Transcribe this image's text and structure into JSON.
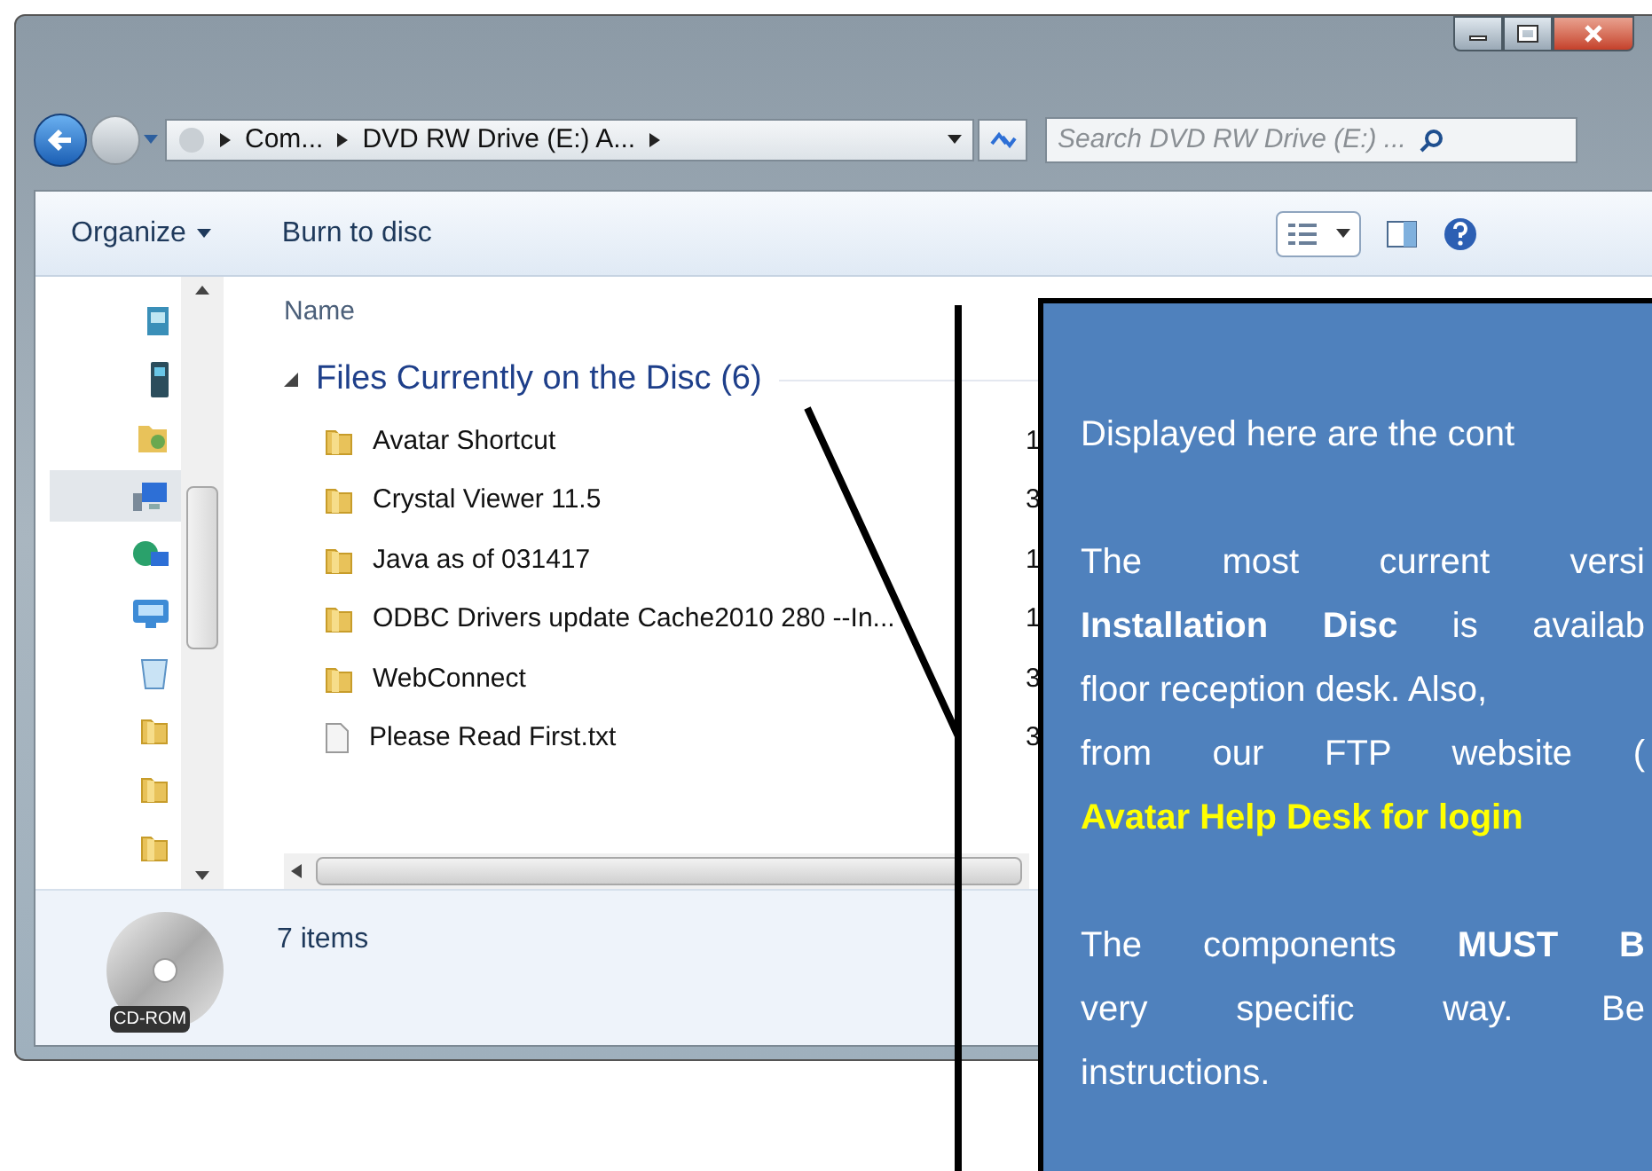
{
  "address_bar": {
    "segments": [
      "Com...",
      "DVD RW Drive (E:) A..."
    ]
  },
  "search": {
    "placeholder": "Search DVD RW Drive (E:) ..."
  },
  "toolbar": {
    "buttons": [
      "Organize",
      "Burn to disc"
    ]
  },
  "nav_pane": {
    "items": [
      {
        "kind": "picture",
        "selected": false
      },
      {
        "kind": "device",
        "selected": false
      },
      {
        "kind": "user",
        "selected": false
      },
      {
        "kind": "computer",
        "selected": true
      },
      {
        "kind": "network",
        "selected": false
      },
      {
        "kind": "panel",
        "selected": false
      },
      {
        "kind": "bin",
        "selected": false
      },
      {
        "kind": "folder",
        "selected": false
      },
      {
        "kind": "folder",
        "selected": false
      },
      {
        "kind": "folder",
        "selected": false
      }
    ]
  },
  "file_list": {
    "columns": [
      "Name"
    ],
    "group": {
      "title": "Files Currently on the Disc (6)",
      "expanded": true
    },
    "rows": [
      {
        "kind": "folder",
        "name": "Avatar Shortcut",
        "column_2": "1"
      },
      {
        "kind": "folder",
        "name": "Crystal Viewer 11.5",
        "column_2": "3"
      },
      {
        "kind": "folder",
        "name": "Java as of 031417",
        "column_2": "1"
      },
      {
        "kind": "folder",
        "name": "ODBC Drivers update Cache2010 280 --In...",
        "column_2": "1"
      },
      {
        "kind": "folder",
        "name": "WebConnect",
        "column_2": "3"
      },
      {
        "kind": "file",
        "name": "Please Read First.txt",
        "column_2": "3"
      }
    ]
  },
  "status_bar": {
    "drive_label": "CD-ROM",
    "count": "7 items"
  },
  "callout": {
    "paragraphs": [
      [
        {
          "text": "Displayed here are the cont",
          "justified": false,
          "highlight": false
        }
      ],
      [
        {
          "text": "The most current versi",
          "justified": true,
          "highlight": false
        },
        {
          "text": "**Installation Disc** is availab",
          "justified": true,
          "highlight": false
        },
        {
          "text": "floor reception desk. Also,",
          "justified": false,
          "highlight": false
        },
        {
          "text": "from our FTP website (",
          "justified": true,
          "highlight": false
        },
        {
          "text": "Avatar Help Desk for login",
          "justified": false,
          "highlight": true
        }
      ],
      [
        {
          "text": "The components **MUST B**",
          "justified": true,
          "highlight": false
        },
        {
          "text": "very specific way. Be",
          "justified": true,
          "highlight": false
        },
        {
          "text": "instructions.",
          "highlight": false
        }
      ]
    ]
  }
}
